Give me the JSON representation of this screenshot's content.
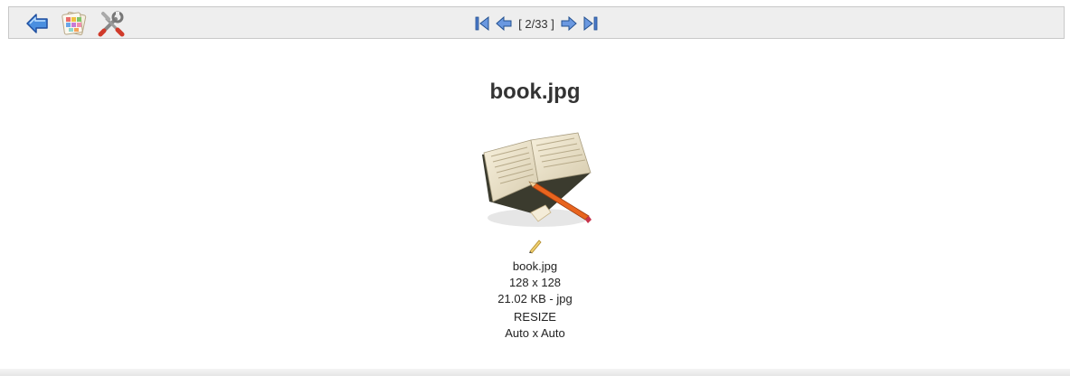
{
  "toolbar": {
    "icons": [
      "back-arrow-icon",
      "color-palette-icon",
      "tools-icon"
    ],
    "nav": {
      "counter": "[ 2/33 ]",
      "icons": [
        "first-page-icon",
        "previous-page-icon",
        "next-page-icon",
        "last-page-icon"
      ]
    }
  },
  "image": {
    "title": "book.jpg",
    "filename": "book.jpg",
    "dimensions": "128 x 128",
    "size_type": "21.02 KB - jpg",
    "resize_label": "RESIZE",
    "resize_value": "Auto x Auto"
  },
  "colors": {
    "toolbar_bg": "#eeeeee",
    "nav_arrow": "#4a78c8",
    "back_arrow": "#3a6cc8"
  }
}
